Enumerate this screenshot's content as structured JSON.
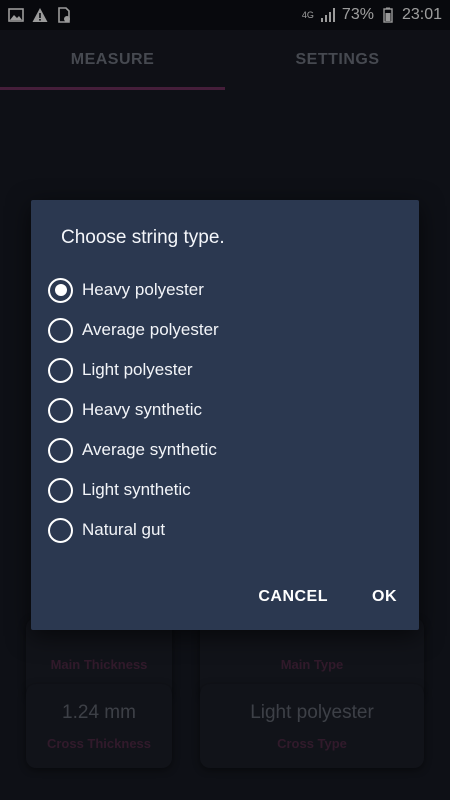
{
  "status_bar": {
    "network": "4G",
    "battery": "73%",
    "time": "23:01",
    "icons": [
      "image-icon",
      "warning-icon",
      "sim-icon",
      "signal-icon",
      "battery-icon"
    ]
  },
  "tabs": [
    {
      "label": "MEASURE",
      "active": true
    },
    {
      "label": "SETTINGS",
      "active": false
    }
  ],
  "cards": [
    {
      "value": "",
      "caption": "Main Thickness"
    },
    {
      "value": "",
      "caption": "Main Type"
    },
    {
      "value": "1.24 mm",
      "caption": "Cross Thickness"
    },
    {
      "value": "Light polyester",
      "caption": "Cross Type"
    }
  ],
  "dialog": {
    "title": "Choose string type.",
    "options": [
      {
        "label": "Heavy polyester",
        "selected": true
      },
      {
        "label": "Average polyester",
        "selected": false
      },
      {
        "label": "Light polyester",
        "selected": false
      },
      {
        "label": "Heavy synthetic",
        "selected": false
      },
      {
        "label": "Average synthetic",
        "selected": false
      },
      {
        "label": "Light synthetic",
        "selected": false
      },
      {
        "label": "Natural gut",
        "selected": false
      }
    ],
    "cancel_label": "CANCEL",
    "ok_label": "OK"
  },
  "colors": {
    "accent": "#6a2e59",
    "dialog_bg": "#2b3850",
    "background": "#161922"
  }
}
